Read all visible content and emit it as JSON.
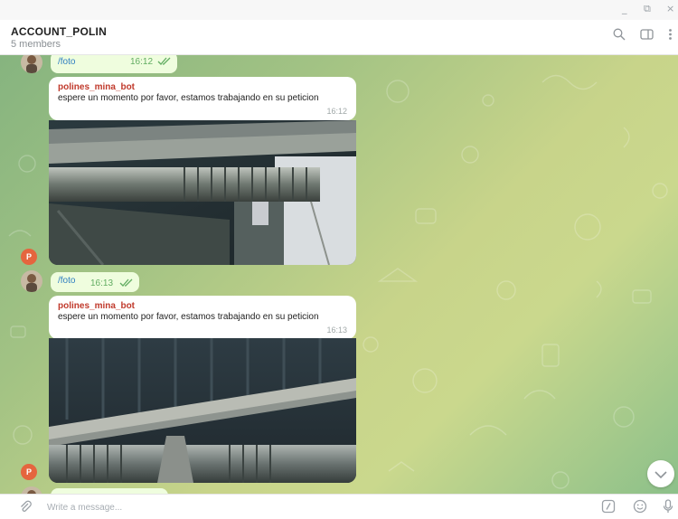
{
  "window": {
    "minimize_glyph": "_",
    "restore_glyph": "⧉",
    "close_glyph": "×"
  },
  "header": {
    "title": "ACCOUNT_POLIN",
    "subtitle": "5 members",
    "icons": [
      "search-icon",
      "sidebar-toggle-icon",
      "more-vertical-icon"
    ]
  },
  "messages": [
    {
      "type": "outgoing",
      "text": "/foto",
      "time": "16:12",
      "status": "read"
    },
    {
      "type": "incoming",
      "sender": "polines_mina_bot",
      "text": "espere un momento por favor, estamos trabajando en su peticion",
      "time": "16:12",
      "avatar_letter": "P",
      "has_photo": true
    },
    {
      "type": "outgoing",
      "text": "/foto",
      "time": "16:13",
      "status": "read"
    },
    {
      "type": "incoming",
      "sender": "polines_mina_bot",
      "text": "espere un momento por favor, estamos trabajando en su peticion",
      "time": "16:13",
      "avatar_letter": "P",
      "has_photo": true
    }
  ],
  "composer": {
    "placeholder": "Write a message...",
    "icons": [
      "attach-icon",
      "bot-commands-icon",
      "emoji-icon",
      "microphone-icon"
    ]
  },
  "colors": {
    "outgoing_bubble": "#effdde",
    "link": "#2f7fc1",
    "sender_name": "#c0392b",
    "avatar_bot": "#e5653e",
    "check": "#62ad62"
  }
}
